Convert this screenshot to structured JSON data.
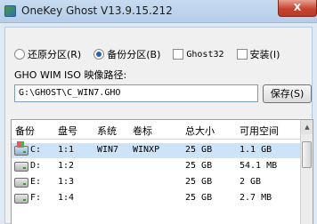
{
  "window": {
    "title": "OneKey Ghost V13.9.15.212",
    "close_label": "X"
  },
  "options": {
    "restore_label": "还原分区(R)",
    "backup_label": "备份分区(B)",
    "ghost32_label": "Ghost32",
    "install_label": "安装(I)",
    "selected": "backup"
  },
  "path": {
    "label": "GHO WIM ISO 映像路径:",
    "value": "G:\\GHOST\\C_WIN7.GHO",
    "save_label": "保存(S)"
  },
  "table": {
    "columns": [
      "备份",
      "盘号",
      "系统",
      "卷标",
      "总大小",
      "可用空间"
    ],
    "rows": [
      {
        "drive": "C:",
        "number": "1:1",
        "system": "WIN7",
        "label": "WINXP",
        "total": "25 GB",
        "free": "1.1 GB",
        "icon": "system-drive-icon",
        "selected": true
      },
      {
        "drive": "D:",
        "number": "1:2",
        "system": "",
        "label": "",
        "total": "25 GB",
        "free": "54.1 MB",
        "icon": "drive-icon",
        "selected": false
      },
      {
        "drive": "E:",
        "number": "1:3",
        "system": "",
        "label": "",
        "total": "25 GB",
        "free": "2 GB",
        "icon": "drive-icon",
        "selected": false
      },
      {
        "drive": "F:",
        "number": "1:4",
        "system": "",
        "label": "",
        "total": "25 GB",
        "free": "2.7 MB",
        "icon": "drive-icon",
        "selected": false
      }
    ]
  }
}
